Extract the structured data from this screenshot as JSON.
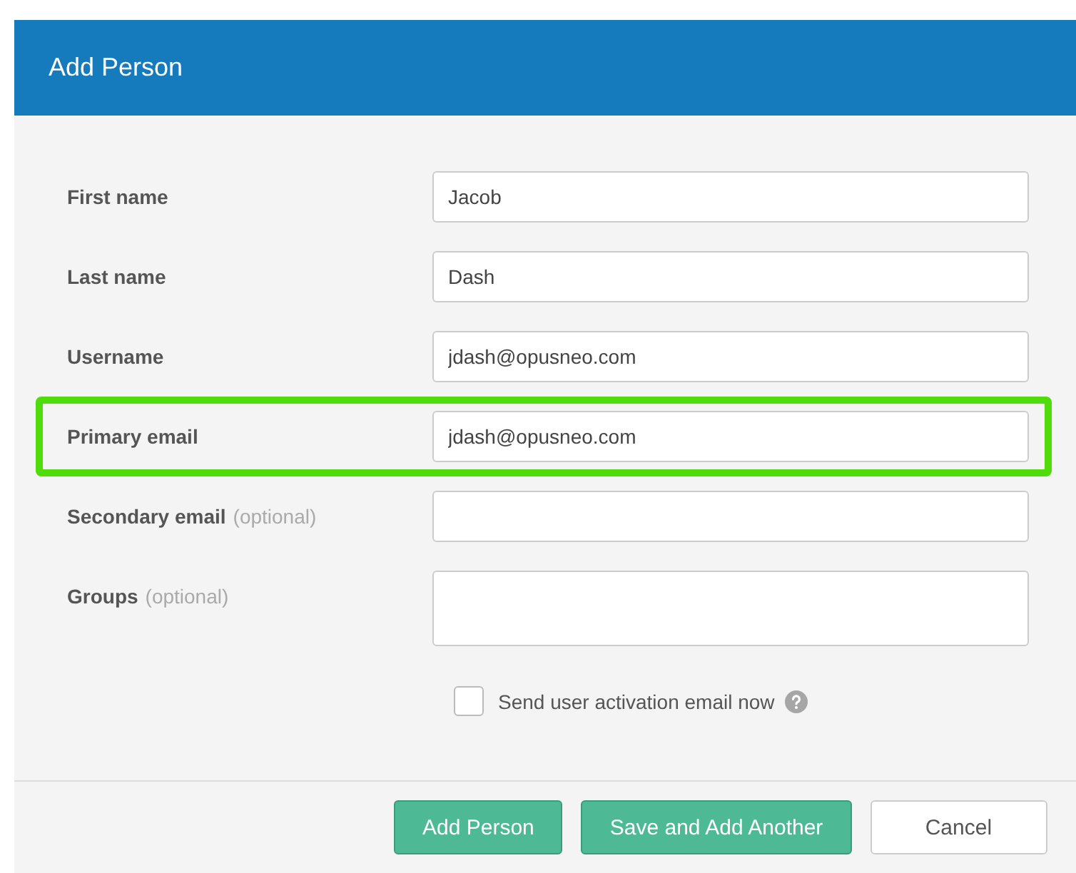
{
  "dialog": {
    "title": "Add Person"
  },
  "fields": [
    {
      "label": "First name",
      "value": "Jacob",
      "kind": "input",
      "highlighted": false
    },
    {
      "label": "Last name",
      "value": "Dash",
      "kind": "input",
      "highlighted": false
    },
    {
      "label": "Username",
      "value": "jdash@opusneo.com",
      "kind": "input",
      "highlighted": false
    },
    {
      "label": "Primary email",
      "value": "jdash@opusneo.com",
      "kind": "input",
      "highlighted": true
    },
    {
      "label": "Secondary email",
      "optional": "(optional)",
      "kind": "input",
      "highlighted": false
    },
    {
      "label": "Groups",
      "optional": "(optional)",
      "kind": "textarea",
      "highlighted": false
    }
  ],
  "activation": {
    "label": "Send user activation email now",
    "checked": false
  },
  "buttons": [
    {
      "label": "Add Person",
      "kind": "primary"
    },
    {
      "label": "Save and Add Another",
      "kind": "primary"
    },
    {
      "label": "Cancel",
      "kind": "secondary"
    }
  ]
}
